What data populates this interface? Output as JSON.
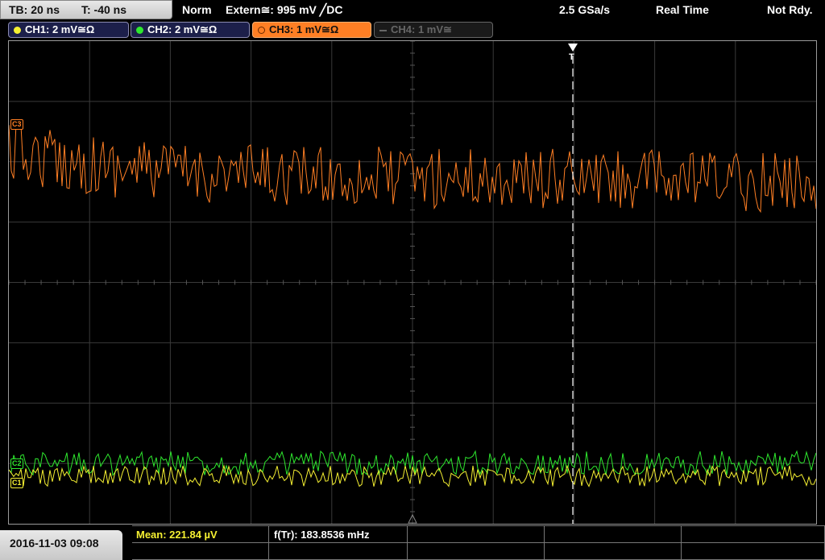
{
  "topbar": {
    "timebase": "TB: 20 ns",
    "trigger_time": "T: -40 ns",
    "acq_mode": "Norm",
    "trigger_source": "Extern≅: 995 mV ╱DC",
    "sample_rate": "2.5 GSa/s",
    "time_mode": "Real Time",
    "trigger_state": "Not Rdy."
  },
  "channels": [
    {
      "label": "CH1: 2 mV≅Ω",
      "color": "#f5f032",
      "active": true
    },
    {
      "label": "CH2: 2 mV≅Ω",
      "color": "#2ee82e",
      "active": true
    },
    {
      "label": "CH3: 1 mV≅Ω",
      "color": "#ff7f24",
      "active": true
    },
    {
      "label": "CH4: 1 mV≅",
      "color": "#666666",
      "active": false
    }
  ],
  "markers": {
    "c3": "C3",
    "c1": "C1",
    "c2": "C2",
    "trigger": "T"
  },
  "colors": {
    "ch1": "#f5f032",
    "ch2": "#2ee82e",
    "ch3": "#ff7f24",
    "grid": "#3a3a3a"
  },
  "measurements": {
    "mean": "Mean: 221.84 µV",
    "freq": "f(Tr): 183.8536 mHz"
  },
  "datetime": "2016-11-03 09:08"
}
